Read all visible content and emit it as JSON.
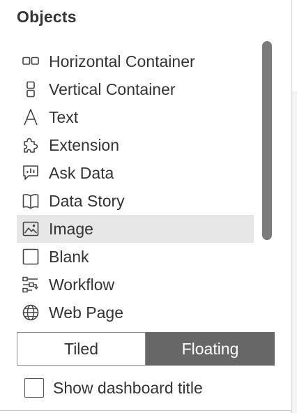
{
  "panel": {
    "title": "Objects"
  },
  "objects": {
    "items": [
      {
        "label": "Horizontal Container",
        "icon": "horizontal-container-icon"
      },
      {
        "label": "Vertical Container",
        "icon": "vertical-container-icon"
      },
      {
        "label": "Text",
        "icon": "text-icon"
      },
      {
        "label": "Extension",
        "icon": "extension-puzzle-icon"
      },
      {
        "label": "Ask Data",
        "icon": "ask-data-icon"
      },
      {
        "label": "Data Story",
        "icon": "data-story-book-icon"
      },
      {
        "label": "Image",
        "icon": "image-icon",
        "selected": true
      },
      {
        "label": "Blank",
        "icon": "blank-icon"
      },
      {
        "label": "Workflow",
        "icon": "workflow-icon"
      },
      {
        "label": "Web Page",
        "icon": "web-page-globe-icon"
      }
    ]
  },
  "layout_toggle": {
    "tiled_label": "Tiled",
    "floating_label": "Floating",
    "selected": "Floating"
  },
  "show_title": {
    "label": "Show dashboard title",
    "checked": false
  },
  "colors": {
    "text": "#333333",
    "selected_row_bg": "#e6e6e6",
    "toggle_active_bg": "#676767",
    "scrollbar": "#7b7b7b"
  }
}
